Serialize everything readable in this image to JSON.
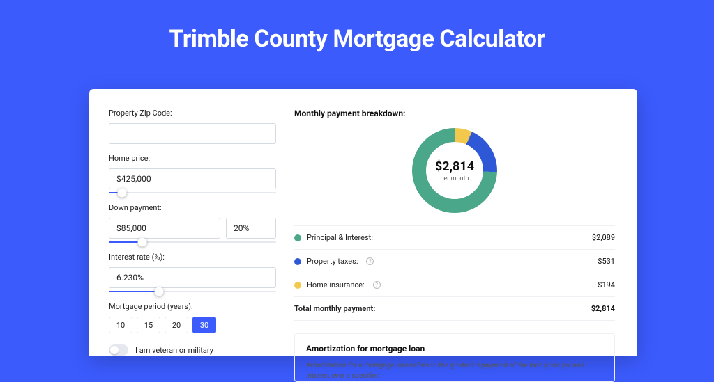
{
  "page": {
    "title": "Trimble County Mortgage Calculator"
  },
  "form": {
    "zip_label": "Property Zip Code:",
    "zip_value": "",
    "home_price_label": "Home price:",
    "home_price_value": "$425,000",
    "home_price_slider_pct": 8,
    "down_payment_label": "Down payment:",
    "down_payment_value": "$85,000",
    "down_payment_pct_value": "20%",
    "down_payment_slider_pct": 20,
    "interest_label": "Interest rate (%):",
    "interest_value": "6.230%",
    "interest_slider_pct": 30,
    "period_label": "Mortgage period (years):",
    "period_options": [
      "10",
      "15",
      "20",
      "30"
    ],
    "period_selected_index": 3,
    "veteran_label": "I am veteran or military",
    "veteran_on": false
  },
  "breakdown": {
    "title": "Monthly payment breakdown:",
    "total": "$2,814",
    "subtext": "per month",
    "rows": [
      {
        "label": "Principal & Interest:",
        "value": "$2,089",
        "color": "green",
        "info": false
      },
      {
        "label": "Property taxes:",
        "value": "$531",
        "color": "blue",
        "info": true
      },
      {
        "label": "Home insurance:",
        "value": "$194",
        "color": "yellow",
        "info": true
      }
    ],
    "total_row": {
      "label": "Total monthly payment:",
      "value": "$2,814"
    }
  },
  "chart_data": {
    "type": "pie",
    "title": "Monthly payment breakdown",
    "series": [
      {
        "name": "Principal & Interest",
        "value": 2089,
        "color": "#4aa789"
      },
      {
        "name": "Property taxes",
        "value": 531,
        "color": "#2f58d6"
      },
      {
        "name": "Home insurance",
        "value": 194,
        "color": "#f2c94c"
      }
    ],
    "center_label": "$2,814",
    "center_sub": "per month"
  },
  "amortization": {
    "title": "Amortization for mortgage loan",
    "text": "Amortization for a mortgage loan refers to the gradual repayment of the loan principal and interest over a specified"
  }
}
